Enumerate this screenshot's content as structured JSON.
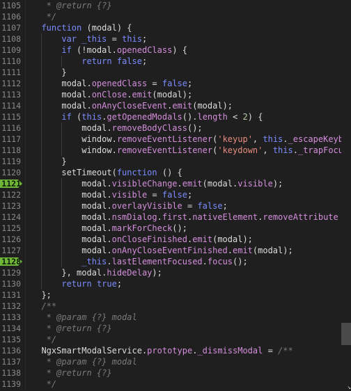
{
  "editor": {
    "scroll_position_label": "scroll",
    "lines": [
      {
        "num": "1105",
        "bp": false,
        "indent": 1,
        "segs": [
          {
            "t": "   * ",
            "c": "cm"
          },
          {
            "t": "@return {?}",
            "c": "cm"
          }
        ]
      },
      {
        "num": "1106",
        "bp": false,
        "indent": 1,
        "segs": [
          {
            "t": "   */",
            "c": "cm"
          }
        ]
      },
      {
        "num": "1107",
        "bp": false,
        "indent": 1,
        "segs": [
          {
            "t": "  "
          },
          {
            "t": "function",
            "c": "kw"
          },
          {
            "t": " (modal) {"
          }
        ]
      },
      {
        "num": "1108",
        "bp": false,
        "indent": 2,
        "segs": [
          {
            "t": "      "
          },
          {
            "t": "var",
            "c": "kw"
          },
          {
            "t": " "
          },
          {
            "t": "_this",
            "c": "kw"
          },
          {
            "t": " = "
          },
          {
            "t": "this",
            "c": "kw"
          },
          {
            "t": ";"
          }
        ]
      },
      {
        "num": "1109",
        "bp": false,
        "indent": 2,
        "segs": [
          {
            "t": "      "
          },
          {
            "t": "if",
            "c": "kw"
          },
          {
            "t": " (!modal."
          },
          {
            "t": "openedClass",
            "c": "prop"
          },
          {
            "t": ") {"
          }
        ]
      },
      {
        "num": "1110",
        "bp": false,
        "indent": 3,
        "segs": [
          {
            "t": "          "
          },
          {
            "t": "return",
            "c": "kw"
          },
          {
            "t": " "
          },
          {
            "t": "false",
            "c": "kw"
          },
          {
            "t": ";"
          }
        ]
      },
      {
        "num": "1111",
        "bp": false,
        "indent": 2,
        "segs": [
          {
            "t": "      }"
          }
        ]
      },
      {
        "num": "1112",
        "bp": false,
        "indent": 2,
        "segs": [
          {
            "t": "      modal."
          },
          {
            "t": "openedClass",
            "c": "prop"
          },
          {
            "t": " = "
          },
          {
            "t": "false",
            "c": "kw"
          },
          {
            "t": ";"
          }
        ]
      },
      {
        "num": "1113",
        "bp": false,
        "indent": 2,
        "segs": [
          {
            "t": "      modal."
          },
          {
            "t": "onClose",
            "c": "prop"
          },
          {
            "t": "."
          },
          {
            "t": "emit",
            "c": "prop"
          },
          {
            "t": "(modal);"
          }
        ]
      },
      {
        "num": "1114",
        "bp": false,
        "indent": 2,
        "segs": [
          {
            "t": "      modal."
          },
          {
            "t": "onAnyCloseEvent",
            "c": "prop"
          },
          {
            "t": "."
          },
          {
            "t": "emit",
            "c": "prop"
          },
          {
            "t": "(modal);"
          }
        ]
      },
      {
        "num": "1115",
        "bp": false,
        "indent": 2,
        "segs": [
          {
            "t": "      "
          },
          {
            "t": "if",
            "c": "kw"
          },
          {
            "t": " ("
          },
          {
            "t": "this",
            "c": "kw"
          },
          {
            "t": "."
          },
          {
            "t": "getOpenedModals",
            "c": "prop"
          },
          {
            "t": "()."
          },
          {
            "t": "length",
            "c": "prop"
          },
          {
            "t": " < "
          },
          {
            "t": "2",
            "c": "num"
          },
          {
            "t": ") {"
          }
        ]
      },
      {
        "num": "1116",
        "bp": false,
        "indent": 3,
        "segs": [
          {
            "t": "          modal."
          },
          {
            "t": "removeBodyClass",
            "c": "prop"
          },
          {
            "t": "();"
          }
        ]
      },
      {
        "num": "1117",
        "bp": false,
        "indent": 3,
        "segs": [
          {
            "t": "          window."
          },
          {
            "t": "removeEventListener",
            "c": "prop"
          },
          {
            "t": "("
          },
          {
            "t": "'keyup'",
            "c": "str"
          },
          {
            "t": ", "
          },
          {
            "t": "this",
            "c": "kw"
          },
          {
            "t": "."
          },
          {
            "t": "_escapeKeyb",
            "c": "prop"
          }
        ]
      },
      {
        "num": "1118",
        "bp": false,
        "indent": 3,
        "segs": [
          {
            "t": "          window."
          },
          {
            "t": "removeEventListener",
            "c": "prop"
          },
          {
            "t": "("
          },
          {
            "t": "'keydown'",
            "c": "str"
          },
          {
            "t": ", "
          },
          {
            "t": "this",
            "c": "kw"
          },
          {
            "t": "."
          },
          {
            "t": "_trapFocu",
            "c": "prop"
          }
        ]
      },
      {
        "num": "1119",
        "bp": false,
        "indent": 2,
        "segs": [
          {
            "t": "      }"
          }
        ]
      },
      {
        "num": "1120",
        "bp": false,
        "indent": 2,
        "segs": [
          {
            "t": "      setTimeout("
          },
          {
            "t": "function",
            "c": "kw"
          },
          {
            "t": " () {"
          }
        ]
      },
      {
        "num": "1121",
        "bp": true,
        "indent": 3,
        "segs": [
          {
            "t": "          modal."
          },
          {
            "t": "visibleChange",
            "c": "prop"
          },
          {
            "t": "."
          },
          {
            "t": "emit",
            "c": "prop"
          },
          {
            "t": "(modal."
          },
          {
            "t": "visible",
            "c": "prop"
          },
          {
            "t": ");"
          }
        ]
      },
      {
        "num": "1122",
        "bp": false,
        "indent": 3,
        "segs": [
          {
            "t": "          modal."
          },
          {
            "t": "visible",
            "c": "prop"
          },
          {
            "t": " = "
          },
          {
            "t": "false",
            "c": "kw"
          },
          {
            "t": ";"
          }
        ]
      },
      {
        "num": "1123",
        "bp": false,
        "indent": 3,
        "segs": [
          {
            "t": "          modal."
          },
          {
            "t": "overlayVisible",
            "c": "prop"
          },
          {
            "t": " = "
          },
          {
            "t": "false",
            "c": "kw"
          },
          {
            "t": ";"
          }
        ]
      },
      {
        "num": "1124",
        "bp": false,
        "indent": 3,
        "segs": [
          {
            "t": "          modal."
          },
          {
            "t": "nsmDialog",
            "c": "prop"
          },
          {
            "t": "."
          },
          {
            "t": "first",
            "c": "prop"
          },
          {
            "t": "."
          },
          {
            "t": "nativeElement",
            "c": "prop"
          },
          {
            "t": "."
          },
          {
            "t": "removeAttribute",
            "c": "prop"
          }
        ]
      },
      {
        "num": "1125",
        "bp": false,
        "indent": 3,
        "segs": [
          {
            "t": "          modal."
          },
          {
            "t": "markForCheck",
            "c": "prop"
          },
          {
            "t": "();"
          }
        ]
      },
      {
        "num": "1126",
        "bp": false,
        "indent": 3,
        "segs": [
          {
            "t": "          modal."
          },
          {
            "t": "onCloseFinished",
            "c": "prop"
          },
          {
            "t": "."
          },
          {
            "t": "emit",
            "c": "prop"
          },
          {
            "t": "(modal);"
          }
        ]
      },
      {
        "num": "1127",
        "bp": false,
        "indent": 3,
        "segs": [
          {
            "t": "          modal."
          },
          {
            "t": "onAnyCloseEventFinished",
            "c": "prop"
          },
          {
            "t": "."
          },
          {
            "t": "emit",
            "c": "prop"
          },
          {
            "t": "(modal);"
          }
        ]
      },
      {
        "num": "1128",
        "bp": true,
        "indent": 3,
        "segs": [
          {
            "t": "          "
          },
          {
            "t": "_this",
            "c": "kw"
          },
          {
            "t": "."
          },
          {
            "t": "lastElementFocused",
            "c": "prop"
          },
          {
            "t": "."
          },
          {
            "t": "focus",
            "c": "prop"
          },
          {
            "t": "();"
          }
        ]
      },
      {
        "num": "1129",
        "bp": false,
        "indent": 2,
        "segs": [
          {
            "t": "      }, modal."
          },
          {
            "t": "hideDelay",
            "c": "prop"
          },
          {
            "t": ");"
          }
        ]
      },
      {
        "num": "1130",
        "bp": false,
        "indent": 2,
        "segs": [
          {
            "t": "      "
          },
          {
            "t": "return",
            "c": "kw"
          },
          {
            "t": " "
          },
          {
            "t": "true",
            "c": "kw"
          },
          {
            "t": ";"
          }
        ]
      },
      {
        "num": "1131",
        "bp": false,
        "indent": 1,
        "segs": [
          {
            "t": "  };"
          }
        ]
      },
      {
        "num": "1132",
        "bp": false,
        "indent": 1,
        "segs": [
          {
            "t": "  /**",
            "c": "cm"
          }
        ]
      },
      {
        "num": "1133",
        "bp": false,
        "indent": 1,
        "segs": [
          {
            "t": "   * @param {?} modal",
            "c": "cm"
          }
        ]
      },
      {
        "num": "1134",
        "bp": false,
        "indent": 1,
        "segs": [
          {
            "t": "   * @return {?}",
            "c": "cm"
          }
        ]
      },
      {
        "num": "1135",
        "bp": false,
        "indent": 1,
        "segs": [
          {
            "t": "   */",
            "c": "cm"
          }
        ]
      },
      {
        "num": "1136",
        "bp": false,
        "indent": 1,
        "segs": [
          {
            "t": "  NgxSmartModalService."
          },
          {
            "t": "prototype",
            "c": "prop"
          },
          {
            "t": "."
          },
          {
            "t": "_dismissModal",
            "c": "prop"
          },
          {
            "t": " = "
          },
          {
            "t": "/**",
            "c": "cm"
          }
        ]
      },
      {
        "num": "1137",
        "bp": false,
        "indent": 1,
        "segs": [
          {
            "t": "   * @param {?} modal",
            "c": "cm"
          }
        ]
      },
      {
        "num": "1138",
        "bp": false,
        "indent": 1,
        "segs": [
          {
            "t": "   * @return {?}",
            "c": "cm"
          }
        ]
      },
      {
        "num": "1139",
        "bp": false,
        "indent": 1,
        "segs": [
          {
            "t": "   */",
            "c": "cm"
          }
        ]
      }
    ]
  },
  "colors": {
    "background": "#1f1f1f",
    "keyword": "#7c8cff",
    "property": "#d48edc",
    "string": "#e78d7e",
    "comment": "#7a7a7a",
    "breakpoint": "#6fb537"
  }
}
